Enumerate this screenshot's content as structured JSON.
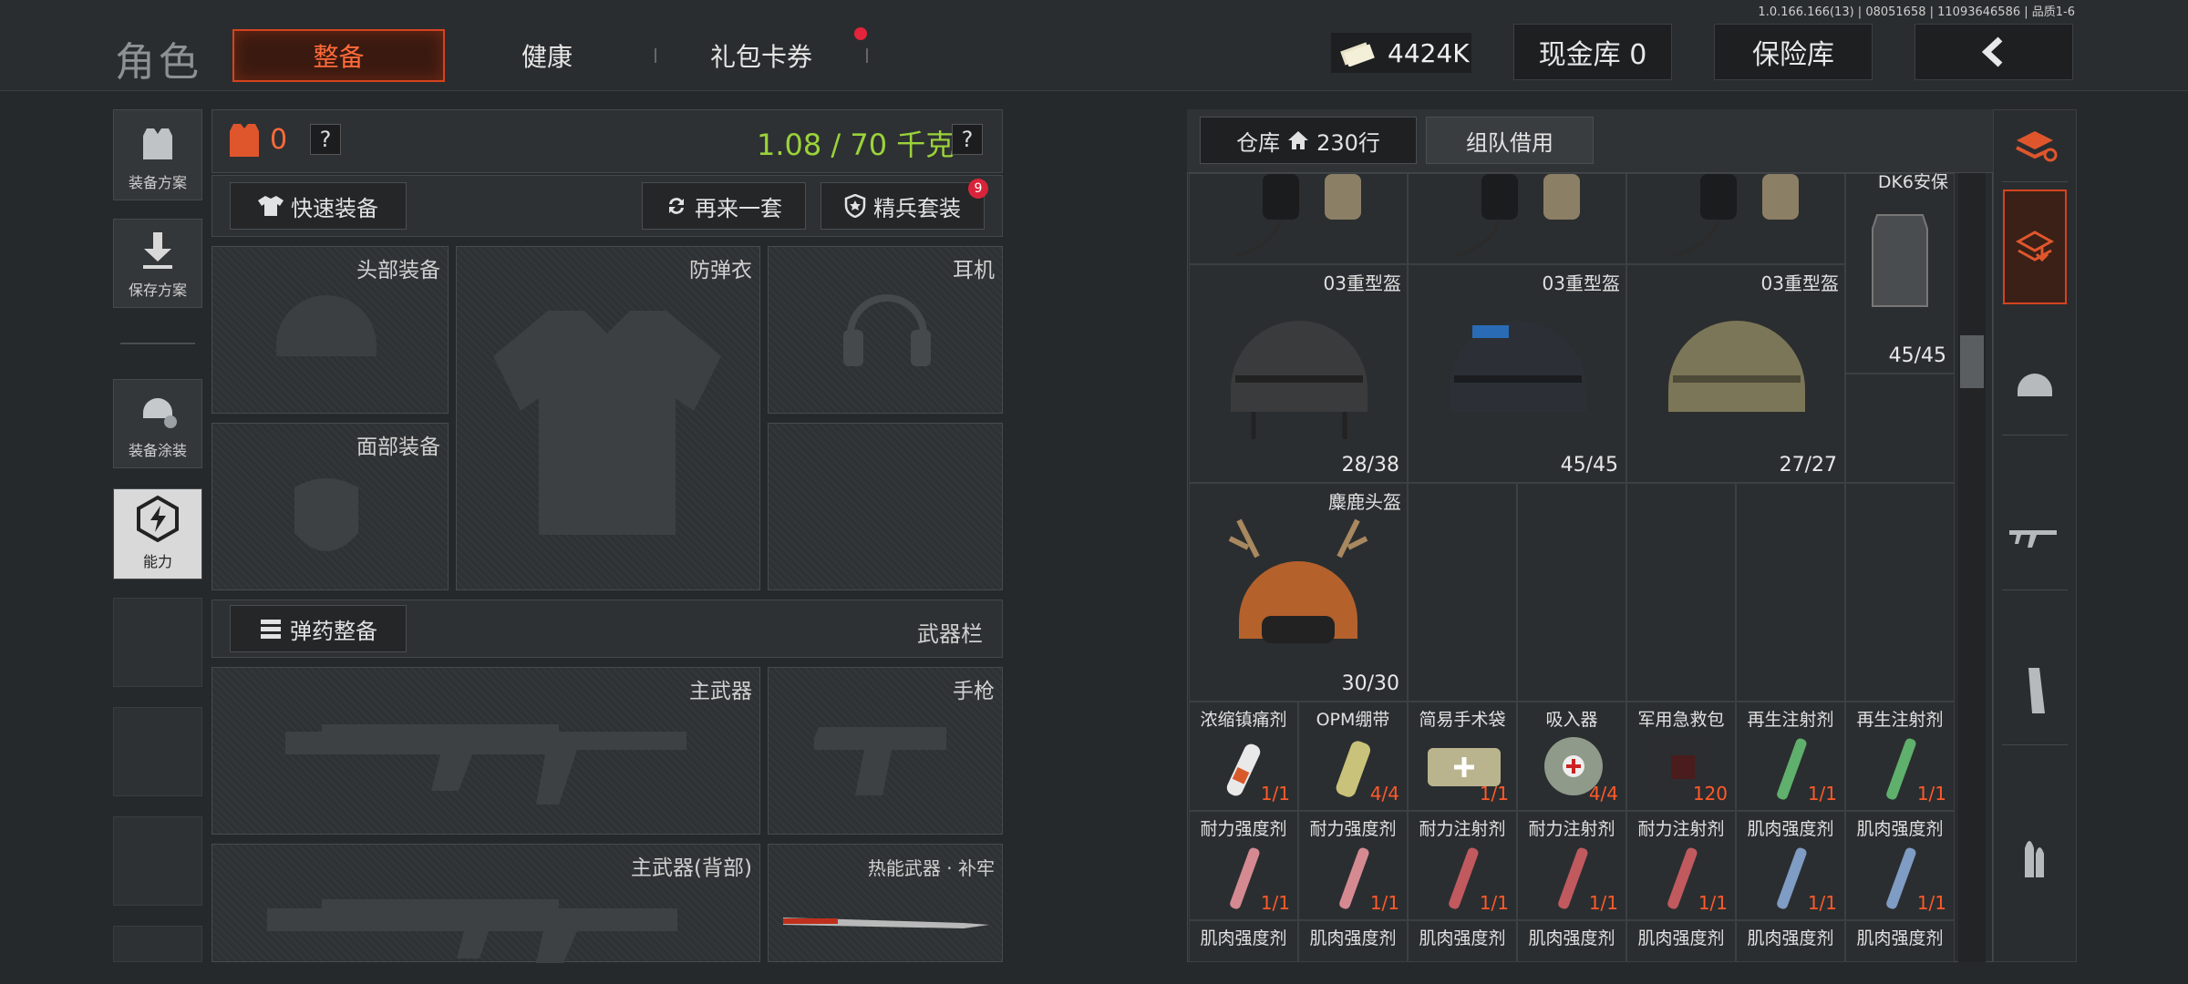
{
  "version": "1.0.166.166(13) | 08051658 | 11093646586 | 品质1-6",
  "header": {
    "title": "角色",
    "tabs": [
      "整备",
      "健康",
      "礼包卡券"
    ],
    "currency": "4424K",
    "cash_vault": "现金库 0",
    "insurance": "保险库"
  },
  "sidebar": {
    "items": [
      "装备方案",
      "保存方案",
      "装备涂装",
      "能力"
    ]
  },
  "loadout": {
    "armor_count": "0",
    "weight": "1.08 / 70 千克",
    "quick_equip": "快速装备",
    "again": "再来一套",
    "elite": "精兵套装",
    "elite_badge": "9",
    "slots": {
      "head": "头部装备",
      "vest": "防弹衣",
      "headset": "耳机",
      "face": "面部装备"
    },
    "ammo_btn": "弹药整备",
    "weapon_bar": "武器栏",
    "weapons": {
      "primary": "主武器",
      "pistol": "手枪",
      "primary_back": "主武器(背部)",
      "melee": "热能武器 · 补牢"
    }
  },
  "warehouse": {
    "tab_storage": "仓库",
    "tab_storage_count": "230行",
    "tab_team": "组队借用",
    "items_big": [
      {
        "name": "DK6安保",
        "count": "45/45"
      },
      {
        "name": "03重型盔",
        "count": "28/38"
      },
      {
        "name": "03重型盔",
        "count": "45/45"
      },
      {
        "name": "03重型盔",
        "count": "27/27"
      },
      {
        "name": "麋鹿头盔",
        "count": "30/30"
      }
    ],
    "items_row1": [
      {
        "name": "浓缩镇痛剂",
        "count": "1/1"
      },
      {
        "name": "OPM绷带",
        "count": "4/4"
      },
      {
        "name": "简易手术袋",
        "count": "1/1"
      },
      {
        "name": "吸入器",
        "count": "4/4"
      },
      {
        "name": "军用急救包",
        "count": "120"
      },
      {
        "name": "再生注射剂",
        "count": "1/1"
      },
      {
        "name": "再生注射剂",
        "count": "1/1"
      }
    ],
    "items_row2": [
      {
        "name": "耐力强度剂",
        "count": "1/1"
      },
      {
        "name": "耐力强度剂",
        "count": "1/1"
      },
      {
        "name": "耐力注射剂",
        "count": "1/1"
      },
      {
        "name": "耐力注射剂",
        "count": "1/1"
      },
      {
        "name": "耐力注射剂",
        "count": "1/1"
      },
      {
        "name": "肌肉强度剂",
        "count": "1/1"
      },
      {
        "name": "肌肉强度剂",
        "count": "1/1"
      }
    ],
    "items_row3": [
      "肌肉强度剂",
      "肌肉强度剂",
      "肌肉强度剂",
      "肌肉强度剂",
      "肌肉强度剂",
      "肌肉强度剂",
      "肌肉强度剂"
    ]
  },
  "colors": {
    "accent": "#d5431f",
    "weight_green": "#9bd33a",
    "count_red": "#ff5a2a"
  }
}
